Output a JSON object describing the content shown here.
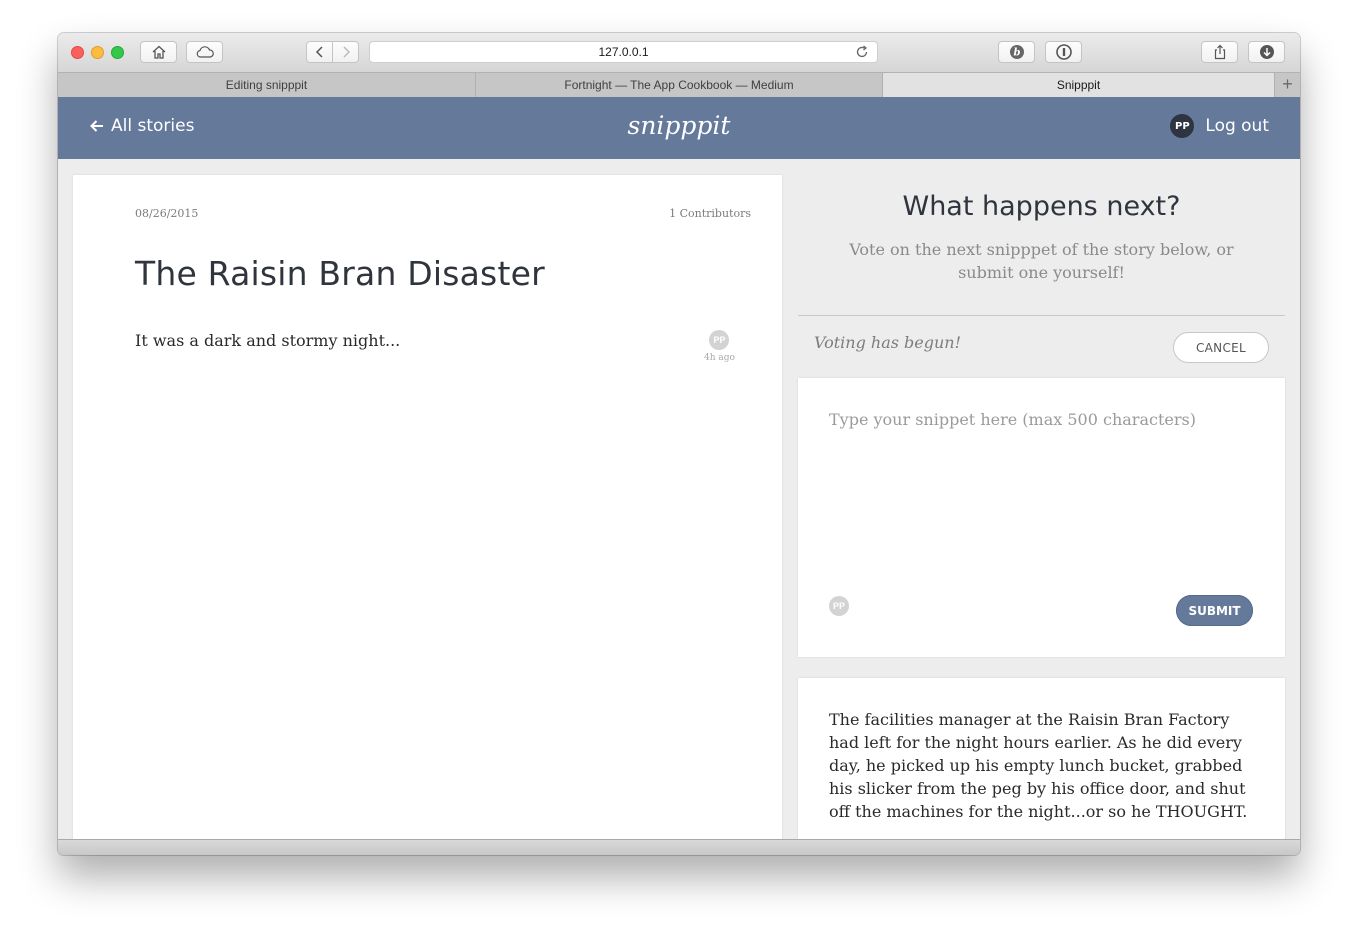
{
  "browser": {
    "url": "127.0.0.1",
    "tabs": [
      {
        "label": "Editing snipppit",
        "active": false
      },
      {
        "label": "Fortnight — The App Cookbook — Medium",
        "active": false
      },
      {
        "label": "Snipppit",
        "active": true
      }
    ],
    "icons": {
      "home": "home-icon",
      "cloud": "cloud-icon",
      "back": "chevron-left-icon",
      "forward": "chevron-right-icon",
      "reload": "reload-icon",
      "ext1": "b-extension-icon",
      "ext2": "1password-icon",
      "share": "share-icon",
      "downloads": "download-icon",
      "new_tab": "plus-icon"
    }
  },
  "header": {
    "back_label": "All stories",
    "brand": "snipppit",
    "user_initials": "PP",
    "logout_label": "Log out",
    "color": "#65799b"
  },
  "story": {
    "date": "08/26/2015",
    "contributors": "1 Contributors",
    "title": "The Raisin Bran Disaster",
    "snippets": [
      {
        "text": "It was a dark and stormy night...",
        "author_initials": "PP",
        "time_ago": "4h ago"
      }
    ]
  },
  "next": {
    "title": "What happens next?",
    "subtitle": "Vote on the next snipppet of the story below, or submit one yourself!",
    "voting_status": "Voting has begun!",
    "cancel_label": "CANCEL",
    "compose": {
      "placeholder": "Type your snippet here (max 500 characters)",
      "value": "",
      "author_initials": "PP",
      "submit_label": "SUBMIT"
    },
    "candidates": [
      {
        "text": "The facilities manager at the Raisin Bran Factory had left for the night hours earlier. As he did every day, he picked up his empty lunch bucket, grabbed his slicker from the peg by his office door, and shut off the machines for the night...or so he THOUGHT."
      }
    ]
  }
}
